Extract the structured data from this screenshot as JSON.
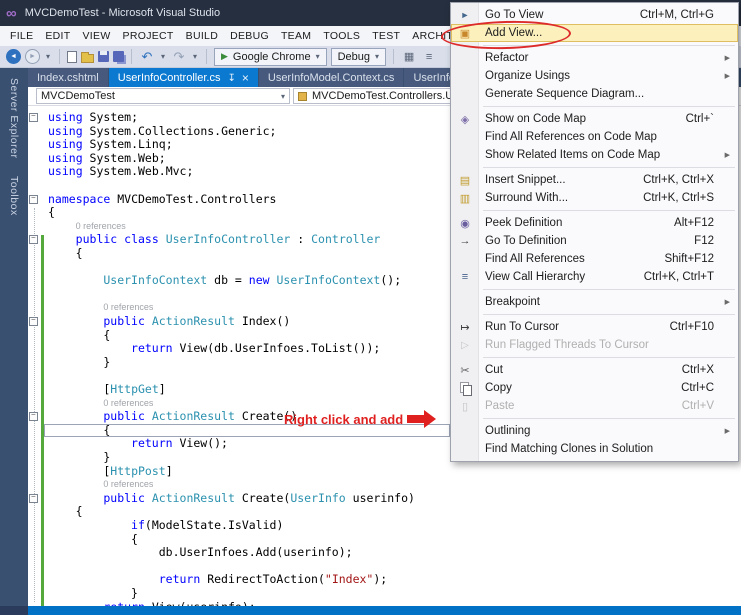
{
  "window": {
    "title": "MVCDemoTest - Microsoft Visual Studio"
  },
  "menubar": {
    "items": [
      "FILE",
      "EDIT",
      "VIEW",
      "PROJECT",
      "BUILD",
      "DEBUG",
      "TEAM",
      "TOOLS",
      "TEST",
      "ARCHITECTURE"
    ]
  },
  "toolbar": {
    "browser_button": "Google Chrome",
    "config_select": "Debug"
  },
  "side_strip": {
    "tabs": [
      "Server Explorer",
      "Toolbox"
    ]
  },
  "doc_tabs": [
    {
      "label": "Index.cshtml",
      "active": false
    },
    {
      "label": "UserInfoController.cs",
      "active": true
    },
    {
      "label": "UserInfoModel.Context.cs",
      "active": false
    },
    {
      "label": "UserInfo.cs",
      "active": false
    }
  ],
  "navbar": {
    "project": "MVCDemoTest",
    "type": "MVCDemoTest.Controllers.UserInfoController"
  },
  "annotation": {
    "text": "Right click and add",
    "color": "#E01F1F"
  },
  "colors": {
    "active_tab": "#0B79D0",
    "title_bar": "#262F3F",
    "side_strip": "#3A5070",
    "status_bar": "#0071C5",
    "keyword": "#0000FF",
    "type": "#2B91AF",
    "string": "#A31515",
    "change_bar_green": "#55A83C",
    "menu_highlight": "#FCF1BD",
    "annotation_red": "#E01F1F"
  },
  "context_menu": {
    "items": [
      {
        "label": "Go To View",
        "shortcut": "Ctrl+M, Ctrl+G",
        "icon": "go-to-view"
      },
      {
        "label": "Add View...",
        "icon": "add-view",
        "highlighted": true
      },
      {
        "sep": true
      },
      {
        "label": "Refactor",
        "submenu": true
      },
      {
        "label": "Organize Usings",
        "submenu": true
      },
      {
        "label": "Generate Sequence Diagram..."
      },
      {
        "sep": true
      },
      {
        "label": "Show on Code Map",
        "shortcut": "Ctrl+`",
        "icon": "code-map"
      },
      {
        "label": "Find All References on Code Map"
      },
      {
        "label": "Show Related Items on Code Map",
        "submenu": true
      },
      {
        "sep": true
      },
      {
        "label": "Insert Snippet...",
        "shortcut": "Ctrl+K, Ctrl+X",
        "icon": "insert-snippet"
      },
      {
        "label": "Surround With...",
        "shortcut": "Ctrl+K, Ctrl+S",
        "icon": "surround-with"
      },
      {
        "sep": true
      },
      {
        "label": "Peek Definition",
        "shortcut": "Alt+F12",
        "icon": "peek-definition"
      },
      {
        "label": "Go To Definition",
        "shortcut": "F12",
        "icon": "go-to-definition"
      },
      {
        "label": "Find All References",
        "shortcut": "Shift+F12"
      },
      {
        "label": "View Call Hierarchy",
        "shortcut": "Ctrl+K, Ctrl+T",
        "icon": "call-hierarchy"
      },
      {
        "sep": true
      },
      {
        "label": "Breakpoint",
        "submenu": true
      },
      {
        "sep": true
      },
      {
        "label": "Run To Cursor",
        "shortcut": "Ctrl+F10",
        "icon": "run-to-cursor"
      },
      {
        "label": "Run Flagged Threads To Cursor",
        "disabled": true,
        "icon": "run-flagged"
      },
      {
        "sep": true
      },
      {
        "label": "Cut",
        "shortcut": "Ctrl+X",
        "icon": "cut"
      },
      {
        "label": "Copy",
        "shortcut": "Ctrl+C",
        "icon": "copy"
      },
      {
        "label": "Paste",
        "shortcut": "Ctrl+V",
        "disabled": true,
        "icon": "paste"
      },
      {
        "sep": true
      },
      {
        "label": "Outlining",
        "submenu": true
      },
      {
        "label": "Find Matching Clones in Solution"
      }
    ]
  },
  "editor": {
    "codelens_text": "0 references",
    "lines": [
      {
        "ind": 0,
        "fold": true,
        "seg": [
          [
            "k",
            "using"
          ],
          [
            "p",
            " System;"
          ]
        ]
      },
      {
        "ind": 0,
        "seg": [
          [
            "k",
            "using"
          ],
          [
            "p",
            " System.Collections.Generic;"
          ]
        ]
      },
      {
        "ind": 0,
        "seg": [
          [
            "k",
            "using"
          ],
          [
            "p",
            " System.Linq;"
          ]
        ]
      },
      {
        "ind": 0,
        "seg": [
          [
            "k",
            "using"
          ],
          [
            "p",
            " System.Web;"
          ]
        ]
      },
      {
        "ind": 0,
        "seg": [
          [
            "k",
            "using"
          ],
          [
            "p",
            " System.Web.Mvc;"
          ]
        ]
      },
      {},
      {
        "ind": 0,
        "fold": true,
        "seg": [
          [
            "k",
            "namespace"
          ],
          [
            "p",
            " MVCDemoTest.Controllers"
          ]
        ]
      },
      {
        "ind": 0,
        "seg": [
          [
            "p",
            "{"
          ]
        ]
      },
      {
        "ind": 4,
        "lens": true
      },
      {
        "ind": 4,
        "fold": true,
        "seg": [
          [
            "k",
            "public"
          ],
          [
            "p",
            " "
          ],
          [
            "k",
            "class"
          ],
          [
            "p",
            " "
          ],
          [
            "t",
            "UserInfoController"
          ],
          [
            "p",
            " : "
          ],
          [
            "t",
            "Controller"
          ]
        ]
      },
      {
        "ind": 4,
        "seg": [
          [
            "p",
            "{"
          ]
        ]
      },
      {},
      {
        "ind": 8,
        "seg": [
          [
            "t",
            "UserInfoContext"
          ],
          [
            "p",
            " db = "
          ],
          [
            "k",
            "new"
          ],
          [
            "p",
            " "
          ],
          [
            "t",
            "UserInfoContext"
          ],
          [
            "p",
            "();"
          ]
        ]
      },
      {},
      {
        "ind": 8,
        "lens": true
      },
      {
        "ind": 8,
        "fold": true,
        "seg": [
          [
            "k",
            "public"
          ],
          [
            "p",
            " "
          ],
          [
            "t",
            "ActionResult"
          ],
          [
            "p",
            " Index()"
          ]
        ]
      },
      {
        "ind": 8,
        "seg": [
          [
            "p",
            "{"
          ]
        ]
      },
      {
        "ind": 12,
        "seg": [
          [
            "k",
            "return"
          ],
          [
            "p",
            " View(db.UserInfoes.ToList());"
          ]
        ]
      },
      {
        "ind": 8,
        "seg": [
          [
            "p",
            "}"
          ]
        ]
      },
      {},
      {
        "ind": 8,
        "seg": [
          [
            "p",
            "["
          ],
          [
            "t",
            "HttpGet"
          ],
          [
            "p",
            "]"
          ]
        ]
      },
      {
        "ind": 8,
        "lens": true
      },
      {
        "ind": 8,
        "fold": true,
        "seg": [
          [
            "k",
            "public"
          ],
          [
            "p",
            " "
          ],
          [
            "t",
            "ActionResult"
          ],
          [
            "p",
            " Create()"
          ]
        ]
      },
      {
        "ind": 8,
        "current": true,
        "seg": [
          [
            "p",
            "{"
          ]
        ]
      },
      {
        "ind": 12,
        "seg": [
          [
            "k",
            "return"
          ],
          [
            "p",
            " View();"
          ]
        ]
      },
      {
        "ind": 8,
        "seg": [
          [
            "p",
            "}"
          ]
        ]
      },
      {
        "ind": 8,
        "seg": [
          [
            "p",
            "["
          ],
          [
            "t",
            "HttpPost"
          ],
          [
            "p",
            "]"
          ]
        ]
      },
      {
        "ind": 8,
        "lens": true
      },
      {
        "ind": 8,
        "fold": true,
        "seg": [
          [
            "k",
            "public"
          ],
          [
            "p",
            " "
          ],
          [
            "t",
            "ActionResult"
          ],
          [
            "p",
            " Create("
          ],
          [
            "t",
            "UserInfo"
          ],
          [
            "p",
            " userinfo)"
          ]
        ]
      },
      {
        "ind": 4,
        "seg": [
          [
            "p",
            "{"
          ]
        ]
      },
      {
        "ind": 12,
        "seg": [
          [
            "k",
            "if"
          ],
          [
            "p",
            "(ModelState.IsValid)"
          ]
        ]
      },
      {
        "ind": 12,
        "seg": [
          [
            "p",
            "{"
          ]
        ]
      },
      {
        "ind": 16,
        "seg": [
          [
            "p",
            "db.UserInfoes.Add(userinfo);"
          ]
        ]
      },
      {},
      {
        "ind": 16,
        "seg": [
          [
            "k",
            "return"
          ],
          [
            "p",
            " RedirectToAction("
          ],
          [
            "s",
            "\"Index\""
          ],
          [
            "p",
            ");"
          ]
        ]
      },
      {
        "ind": 12,
        "seg": [
          [
            "p",
            "}"
          ]
        ]
      },
      {
        "ind": 8,
        "seg": [
          [
            "k",
            "return"
          ],
          [
            "p",
            " View(userinfo);"
          ]
        ]
      }
    ]
  }
}
